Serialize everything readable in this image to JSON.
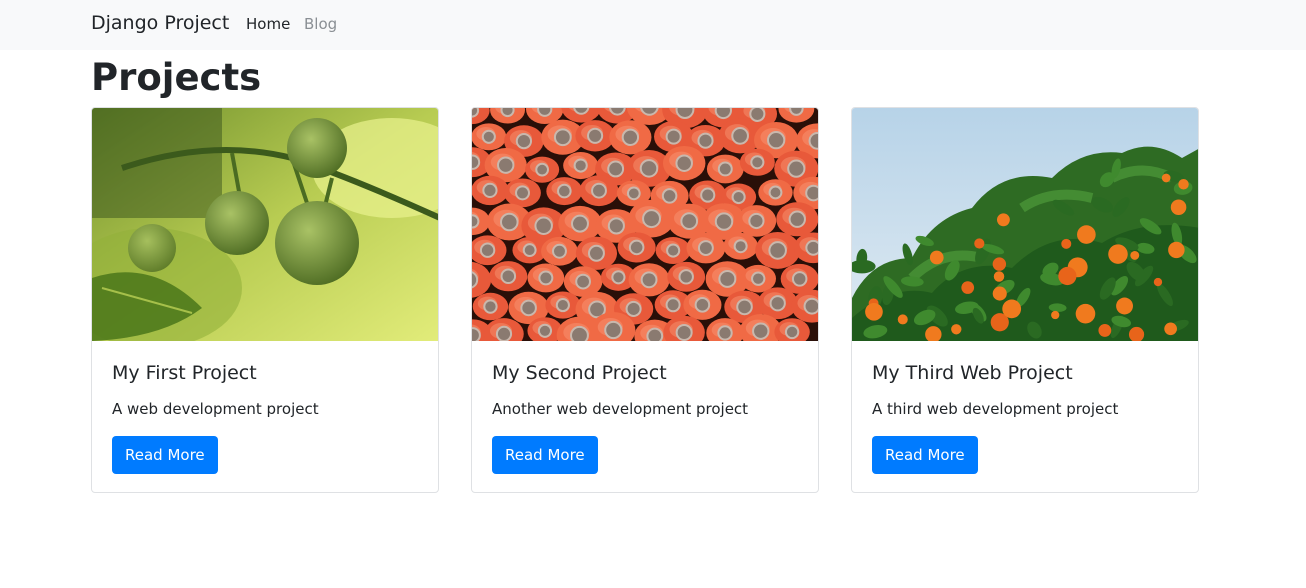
{
  "navbar": {
    "brand": "Django Project",
    "links": [
      {
        "label": "Home"
      },
      {
        "label": "Blog"
      }
    ]
  },
  "page": {
    "title": "Projects"
  },
  "projects": [
    {
      "title": "My First Project",
      "description": "A web development project",
      "button_label": "Read More",
      "image": "green-tomatoes-photo"
    },
    {
      "title": "My Second Project",
      "description": "Another web development project",
      "button_label": "Read More",
      "image": "carrots-photo"
    },
    {
      "title": "My Third Web Project",
      "description": "A third web development project",
      "button_label": "Read More",
      "image": "orange-tree-photo"
    }
  ],
  "colors": {
    "navbar_bg": "#f8f9fa",
    "primary": "#007bff",
    "text": "#212529",
    "muted_link": "#8a8f94"
  }
}
